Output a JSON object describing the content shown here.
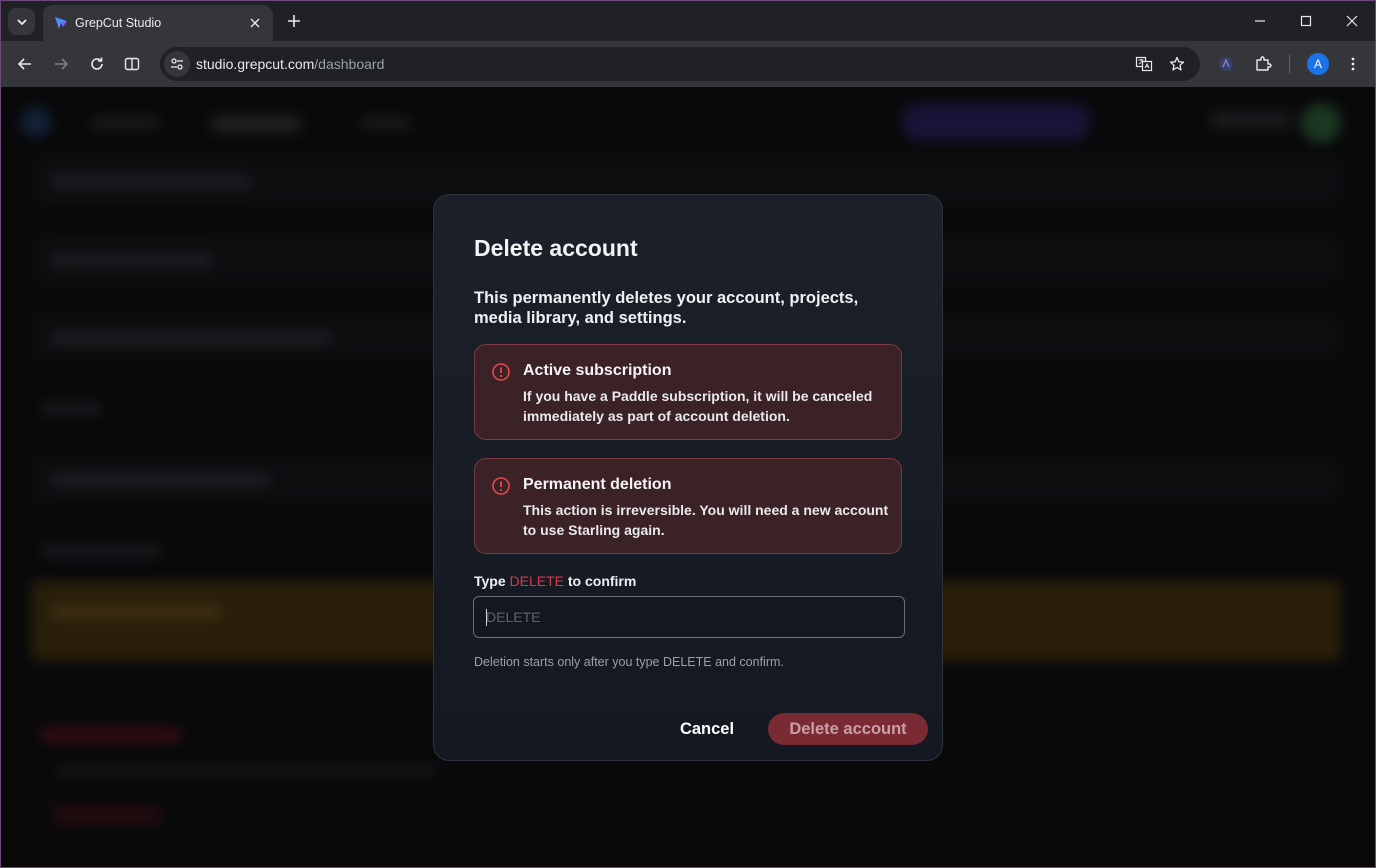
{
  "browser": {
    "tab_title": "GrepCut Studio",
    "url_host": "studio.grepcut.com",
    "url_path": "/dashboard",
    "profile_initial": "A"
  },
  "dialog": {
    "title": "Delete account",
    "description": "This permanently deletes your account, projects, media library, and settings.",
    "alerts": [
      {
        "icon": "alert-circle-icon",
        "title": "Active subscription",
        "body": "If you have a Paddle subscription, it will be canceled immediately as part of account deletion."
      },
      {
        "icon": "alert-circle-icon",
        "title": "Permanent deletion",
        "body": "This action is irreversible. You will need a new account to use Starling again."
      }
    ],
    "confirm": {
      "label_prefix": "Type ",
      "keyword": "DELETE",
      "label_suffix": " to confirm",
      "value": "",
      "placeholder": "DELETE",
      "hint": "Deletion starts only after you type DELETE and confirm."
    },
    "cancel_label": "Cancel",
    "delete_label": "Delete account"
  },
  "colors": {
    "accent_red": "#d9364a",
    "alert_bg": "#3a2226",
    "delete_button_disabled": "#7a2a33"
  }
}
